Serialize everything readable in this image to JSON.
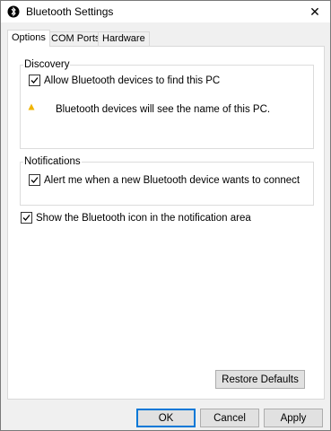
{
  "window": {
    "title": "Bluetooth Settings",
    "close_glyph": "✕",
    "title_icon": "bluetooth-icon"
  },
  "tabs": [
    {
      "label": "Options",
      "active": true
    },
    {
      "label": "COM Ports",
      "active": false
    },
    {
      "label": "Hardware",
      "active": false
    }
  ],
  "discovery": {
    "group_label": "Discovery",
    "allow_label": "Allow Bluetooth devices to find this PC",
    "allow_checked": true,
    "warning_icon": "warning-icon",
    "info_text": "Bluetooth devices will see the name of this PC."
  },
  "notifications": {
    "group_label": "Notifications",
    "alert_label": "Alert me when a new Bluetooth device wants to connect",
    "alert_checked": true
  },
  "show_icon": {
    "label": "Show the Bluetooth icon in the notification area",
    "checked": true
  },
  "buttons": {
    "restore_defaults": "Restore Defaults",
    "ok": "OK",
    "cancel": "Cancel",
    "apply": "Apply"
  },
  "colors": {
    "accent": "#0078d7",
    "warning": "#f0b400",
    "bluetooth": "#000000"
  }
}
